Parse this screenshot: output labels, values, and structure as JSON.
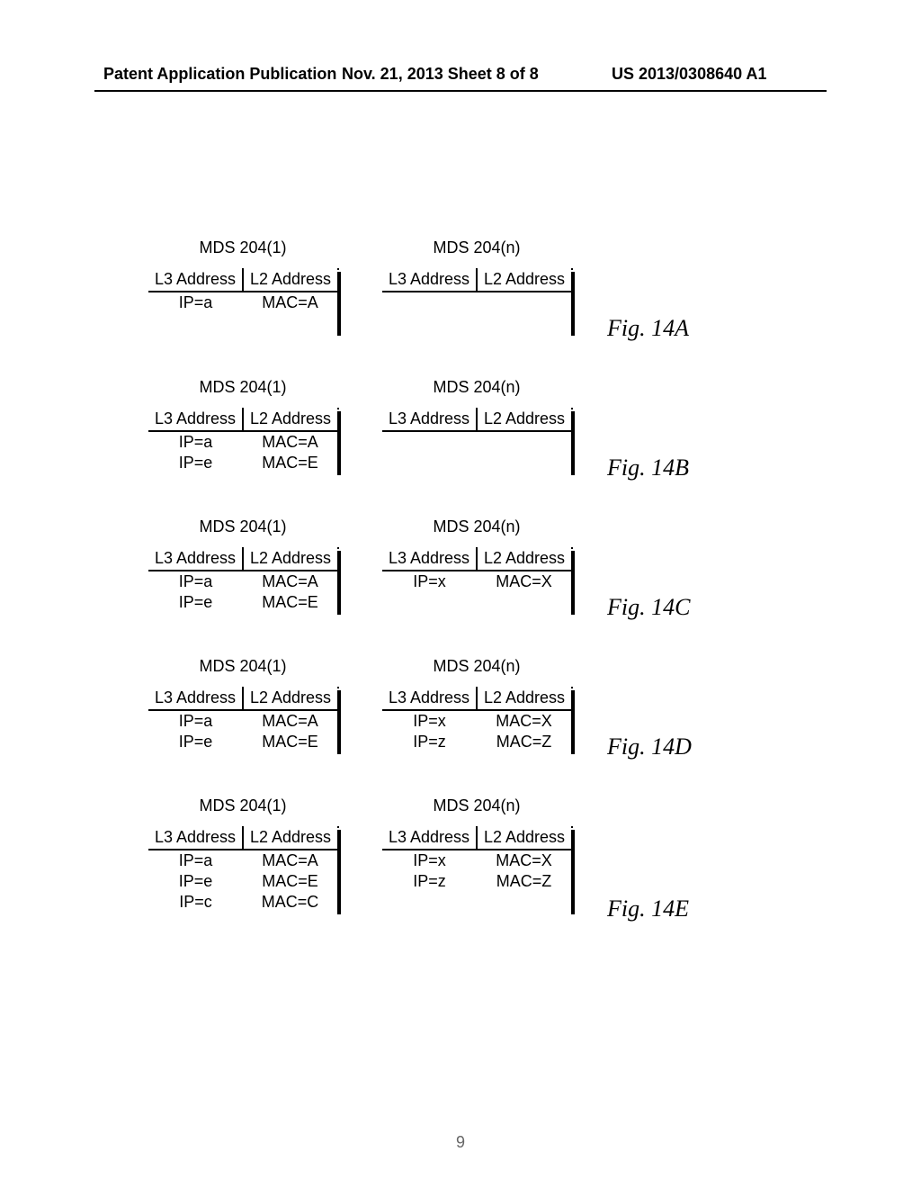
{
  "header": {
    "left": "Patent Application Publication",
    "center": "Nov. 21, 2013  Sheet 8 of 8",
    "right": "US 2013/0308640 A1"
  },
  "cols": {
    "l3": "L3 Address",
    "l2": "L2 Address"
  },
  "figs": [
    {
      "label": "Fig. 14A",
      "left": {
        "title": "MDS  204(1)",
        "rows": [
          [
            "IP=a",
            "MAC=A"
          ]
        ]
      },
      "right": {
        "title": "MDS  204(n)",
        "rows": []
      }
    },
    {
      "label": "Fig. 14B",
      "left": {
        "title": "MDS  204(1)",
        "rows": [
          [
            "IP=a",
            "MAC=A"
          ],
          [
            "IP=e",
            "MAC=E"
          ]
        ]
      },
      "right": {
        "title": "MDS  204(n)",
        "rows": []
      }
    },
    {
      "label": "Fig. 14C",
      "left": {
        "title": "MDS  204(1)",
        "rows": [
          [
            "IP=a",
            "MAC=A"
          ],
          [
            "IP=e",
            "MAC=E"
          ]
        ]
      },
      "right": {
        "title": "MDS  204(n)",
        "rows": [
          [
            "IP=x",
            "MAC=X"
          ]
        ]
      }
    },
    {
      "label": "Fig. 14D",
      "left": {
        "title": "MDS  204(1)",
        "rows": [
          [
            "IP=a",
            "MAC=A"
          ],
          [
            "IP=e",
            "MAC=E"
          ]
        ]
      },
      "right": {
        "title": "MDS  204(n)",
        "rows": [
          [
            "IP=x",
            "MAC=X"
          ],
          [
            "IP=z",
            "MAC=Z"
          ]
        ]
      }
    },
    {
      "label": "Fig. 14E",
      "left": {
        "title": "MDS  204(1)",
        "rows": [
          [
            "IP=a",
            "MAC=A"
          ],
          [
            "IP=e",
            "MAC=E"
          ],
          [
            "IP=c",
            "MAC=C"
          ]
        ]
      },
      "right": {
        "title": "MDS  204(n)",
        "rows": [
          [
            "IP=x",
            "MAC=X"
          ],
          [
            "IP=z",
            "MAC=Z"
          ]
        ]
      }
    }
  ],
  "pagenum": "9"
}
